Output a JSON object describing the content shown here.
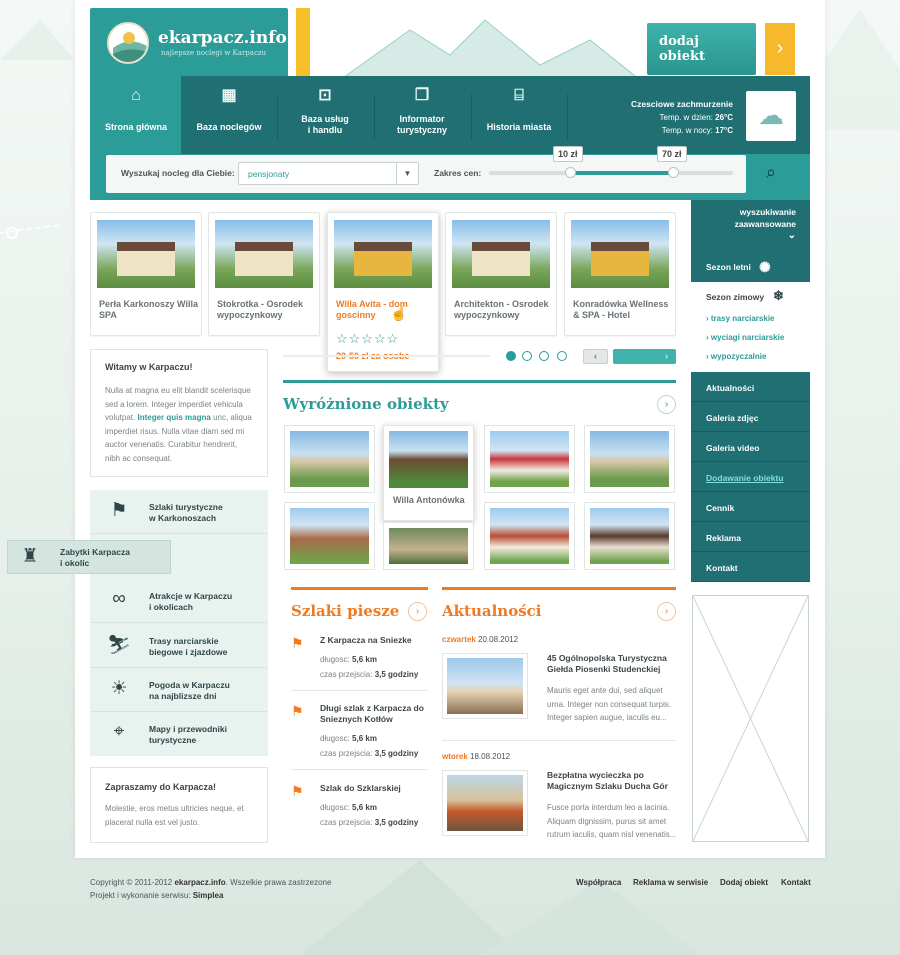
{
  "header": {
    "site_title": "ekarpacz.info",
    "site_tagline": "najlepsze noclegi w Karpaczu",
    "add_label_1": "dodaj",
    "add_label_2": "obiekt",
    "add_arrow": "›"
  },
  "nav": [
    {
      "label": "Strona główna",
      "icon": "home-icon",
      "glyph": "⌂"
    },
    {
      "label": "Baza noclegów",
      "icon": "hotel-icon",
      "glyph": "▦"
    },
    {
      "label": "Baza usług\ni handlu",
      "icon": "shop-icon",
      "glyph": "⊡"
    },
    {
      "label": "Informator\nturystyczny",
      "icon": "info-book-icon",
      "glyph": "❐"
    },
    {
      "label": "Historia miasta",
      "icon": "museum-icon",
      "glyph": "⌸"
    }
  ],
  "weather": {
    "headline": "Czesciowe zachmurzenie",
    "day_label": "Temp. w dzien:",
    "day_value": "26°C",
    "night_label": "Temp. w nocy:",
    "night_value": "17°C",
    "icon": "weather-cloud-rain-icon",
    "glyph": "☁"
  },
  "search": {
    "label": "Wyszukaj nocleg dla Ciebie:",
    "select_value": "pensjonaty",
    "price_label": "Zakres cen:",
    "price_min": "10 zł",
    "price_max": "70 zł",
    "range_min_fraction": 0.33,
    "range_max_fraction": 0.75,
    "search_glyph": "⌕",
    "advanced_1": "wyszukiwanie",
    "advanced_2": "zaawansowane",
    "advanced_chevron": "⌄"
  },
  "featured_slider": [
    {
      "title": "Perła Karkonoszy Willa SPA"
    },
    {
      "title": "Stokrotka - Osrodek wypoczynkowy"
    },
    {
      "title": "Willa Avita - dom goscinny",
      "stars": "☆☆☆☆☆",
      "price": "20-50 zł za osobe",
      "rating_stars": 0
    },
    {
      "title": "Architekton - Osrodek wypoczynkowy"
    },
    {
      "title": "Konradówka Wellness & SPA - Hotel"
    }
  ],
  "slider_nav": {
    "prev": "‹",
    "next": "›"
  },
  "welcome": {
    "title": "Witamy w Karpaczu!",
    "text_1": "Nulla at magna eu elit blandit scelerisque sed a lorem. Integer imperdiet vehicula volutpat.",
    "text_link": "Integer quis magna",
    "text_2": "unc, aliqua imperdiet risus. Nulla vitae diam sed mi auctor venenatis. Curabitur hendrerit, nibh ac consequat."
  },
  "left_menu": [
    {
      "label": "Szlaki turystyczne\nw Karkonoszach",
      "icon": "signpost-icon",
      "glyph": "⚑"
    },
    {
      "label": "Zabytki Karpacza\ni okolic",
      "icon": "castle-icon",
      "glyph": "♜"
    },
    {
      "label": "Atrakcje w Karpaczu\ni okolicach",
      "icon": "binoculars-icon",
      "glyph": "∞"
    },
    {
      "label": "Trasy narciarskie\nbiegowe i zjazdowe",
      "icon": "skier-icon",
      "glyph": "⛷"
    },
    {
      "label": "Pogoda w Karpaczu\nna najblizsze dni",
      "icon": "weather-icon",
      "glyph": "☀"
    },
    {
      "label": "Mapy i przewodniki\nturystyczne",
      "icon": "map-icon",
      "glyph": "⌖"
    }
  ],
  "invite": {
    "title": "Zapraszamy do Karpacza!",
    "text": "Molestie, eros metus ultricies neque, et placerat nulla est vel justo."
  },
  "featured": {
    "title": "Wyróżnione obiekty",
    "hover_caption": "Willa Antonówka",
    "more": "›"
  },
  "trails": {
    "title": "Szlaki piesze",
    "more": "›",
    "length_label": "długosc:",
    "time_label": "czas przejscia:",
    "items": [
      {
        "title": "Z Karpacza na Sniezke",
        "length": "5,6 km",
        "time": "3,5 godziny"
      },
      {
        "title": "Długi szlak z Karpacza do Snieznych Kotłów",
        "length": "5,6 km",
        "time": "3,5 godziny"
      },
      {
        "title": "Szlak do Szklarskiej",
        "length": "5,6 km",
        "time": "3,5 godziny"
      }
    ]
  },
  "news": {
    "title": "Aktualności",
    "more": "›",
    "items": [
      {
        "day": "czwartek",
        "date": "20.08.2012",
        "title": "45 Ogólnopolska Turystyczna Giełda Piosenki Studenckiej",
        "text": "Mauris eget ante dui, sed aliquet urna. Integer non consequat turpis. Integer sapien augue, iaculis eu..."
      },
      {
        "day": "wtorek",
        "date": "18.08.2012",
        "title": "Bezpłatna wycieczka po Magicznym Szlaku Ducha Gór",
        "text": "Fusce porta interdum leo a lacinia. Aliquam dignissim, purus sit amet rutrum iaculis, quam nisl venenatis..."
      }
    ]
  },
  "right_side": {
    "summer": "Sezon letni",
    "winter": "Sezon zimowy",
    "winter_links": [
      "trasy narciarskie",
      "wyciagi narciarskie",
      "wypozyczalnie"
    ],
    "nav": [
      "Aktualności",
      "Galeria zdjęc",
      "Galeria video",
      "Dodawanie obiektu",
      "Cennik",
      "Reklama",
      "Kontakt"
    ]
  },
  "footer": {
    "copy_1": "Copyright © 2011-2012",
    "copy_site": "ekarpacz.info",
    "copy_2": ". Wszelkie prawa zastrzezone",
    "credit_1": "Projekt i wykonanie serwisu:",
    "credit_name": "Simplea",
    "links": [
      "Współpraca",
      "Reklama w serwisie",
      "Dodaj obiekt",
      "Kontakt"
    ]
  },
  "colors": {
    "teal": "#2b9c98",
    "dark_teal": "#1f6f73",
    "orange": "#ef7a22",
    "yellow": "#f7c02b"
  }
}
